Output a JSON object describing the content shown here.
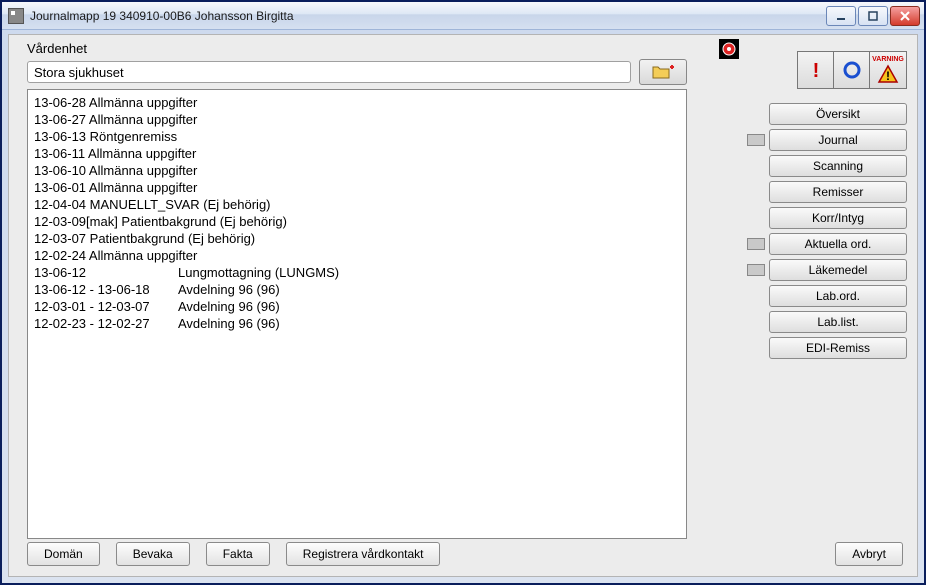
{
  "title": "Journalmapp 19 340910-00B6  Johansson Birgitta",
  "labels": {
    "vardenhet": "Vårdenhet",
    "care_unit": "Stora sjukhuset"
  },
  "entries": [
    {
      "date": "13-06-28",
      "text": "Allmänna uppgifter"
    },
    {
      "date": "13-06-27",
      "text": "Allmänna uppgifter"
    },
    {
      "date": "13-06-13",
      "text": "Röntgenremiss"
    },
    {
      "date": "13-06-11",
      "text": "Allmänna uppgifter"
    },
    {
      "date": "13-06-10",
      "text": "Allmänna uppgifter"
    },
    {
      "date": "13-06-01",
      "text": "Allmänna uppgifter"
    },
    {
      "date": "12-04-04",
      "text": "MANUELLT_SVAR (Ej behörig)"
    },
    {
      "date": "12-03-09[mak]",
      "text": "Patientbakgrund (Ej behörig)"
    },
    {
      "date": "12-03-07",
      "text": "Patientbakgrund (Ej behörig)"
    },
    {
      "date": "12-02-24",
      "text": "Allmänna uppgifter"
    },
    {
      "date": "13-06-12",
      "text": "Lungmottagning (LUNGMS)",
      "indent": true
    },
    {
      "date": "13-06-12 - 13-06-18",
      "text": "Avdelning 96 (96)",
      "indent": true
    },
    {
      "date": "12-03-01 - 12-03-07",
      "text": "Avdelning 96 (96)",
      "indent": true
    },
    {
      "date": "12-02-23 - 12-02-27",
      "text": "Avdelning 96 (96)",
      "indent": true
    }
  ],
  "bottom_buttons": {
    "doman": "Domän",
    "bevaka": "Bevaka",
    "fakta": "Fakta",
    "registrera": "Registrera vårdkontakt",
    "avbryt": "Avbryt"
  },
  "alert_strip": {
    "warning_label": "VARNING"
  },
  "side_buttons": [
    {
      "label": "Översikt",
      "check": false
    },
    {
      "label": "Journal",
      "check": true
    },
    {
      "label": "Scanning",
      "check": false
    },
    {
      "label": "Remisser",
      "check": false
    },
    {
      "label": "Korr/Intyg",
      "check": false
    },
    {
      "label": "Aktuella ord.",
      "check": true
    },
    {
      "label": "Läkemedel",
      "check": true
    },
    {
      "label": "Lab.ord.",
      "check": false
    },
    {
      "label": "Lab.list.",
      "check": false
    },
    {
      "label": "EDI-Remiss",
      "check": false
    }
  ]
}
